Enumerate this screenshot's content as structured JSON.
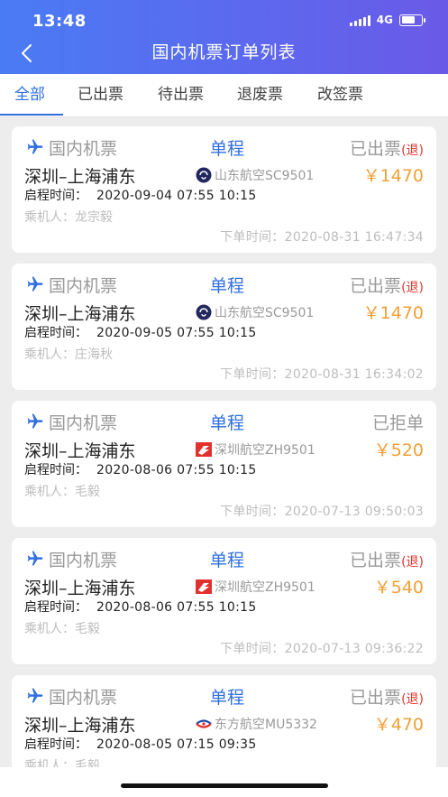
{
  "status_bar": {
    "time": "13:48",
    "network": "4G"
  },
  "nav": {
    "title": "国内机票订单列表"
  },
  "tabs": [
    {
      "label": "全部",
      "active": true
    },
    {
      "label": "已出票",
      "active": false
    },
    {
      "label": "待出票",
      "active": false
    },
    {
      "label": "退废票",
      "active": false
    },
    {
      "label": "改签票",
      "active": false
    }
  ],
  "colors": {
    "accent": "#2f6fe0",
    "price": "#f0a035",
    "refund": "#e0362c",
    "header_start": "#4a7bf5",
    "header_end": "#6a5ae8"
  },
  "orders": [
    {
      "type": "国内机票",
      "trip": "单程",
      "status": "已出票",
      "refund": "(退)",
      "route": "深圳–上海浦东",
      "airline_icon": "shandong-airlines-logo",
      "airline": "山东航空SC9501",
      "price": "￥1470",
      "depart_label": "启程时间：",
      "depart": "2020-09-04 07:55  10:15",
      "passenger": "乘机人：龙宗毅",
      "order_time": "下单时间：2020-08-31 16:47:34"
    },
    {
      "type": "国内机票",
      "trip": "单程",
      "status": "已出票",
      "refund": "(退)",
      "route": "深圳–上海浦东",
      "airline_icon": "shandong-airlines-logo",
      "airline": "山东航空SC9501",
      "price": "￥1470",
      "depart_label": "启程时间：",
      "depart": "2020-09-05 07:55  10:15",
      "passenger": "乘机人：庄海秋",
      "order_time": "下单时间：2020-08-31 16:34:02"
    },
    {
      "type": "国内机票",
      "trip": "单程",
      "status": "已拒单",
      "refund": "",
      "route": "深圳–上海浦东",
      "airline_icon": "shenzhen-airlines-logo",
      "airline": "深圳航空ZH9501",
      "price": "￥520",
      "depart_label": "启程时间：",
      "depart": "2020-08-06 07:55  10:15",
      "passenger": "乘机人：毛毅",
      "order_time": "下单时间：2020-07-13 09:50:03"
    },
    {
      "type": "国内机票",
      "trip": "单程",
      "status": "已出票",
      "refund": "(退)",
      "route": "深圳–上海浦东",
      "airline_icon": "shenzhen-airlines-logo",
      "airline": "深圳航空ZH9501",
      "price": "￥540",
      "depart_label": "启程时间：",
      "depart": "2020-08-06 07:55  10:15",
      "passenger": "乘机人：毛毅",
      "order_time": "下单时间：2020-07-13 09:36:22"
    },
    {
      "type": "国内机票",
      "trip": "单程",
      "status": "已出票",
      "refund": "(退)",
      "route": "深圳–上海浦东",
      "airline_icon": "china-eastern-logo",
      "airline": "东方航空MU5332",
      "price": "￥470",
      "depart_label": "启程时间：",
      "depart": "2020-08-05 07:15  09:35",
      "passenger": "乘机人：毛毅",
      "order_time": ""
    }
  ]
}
